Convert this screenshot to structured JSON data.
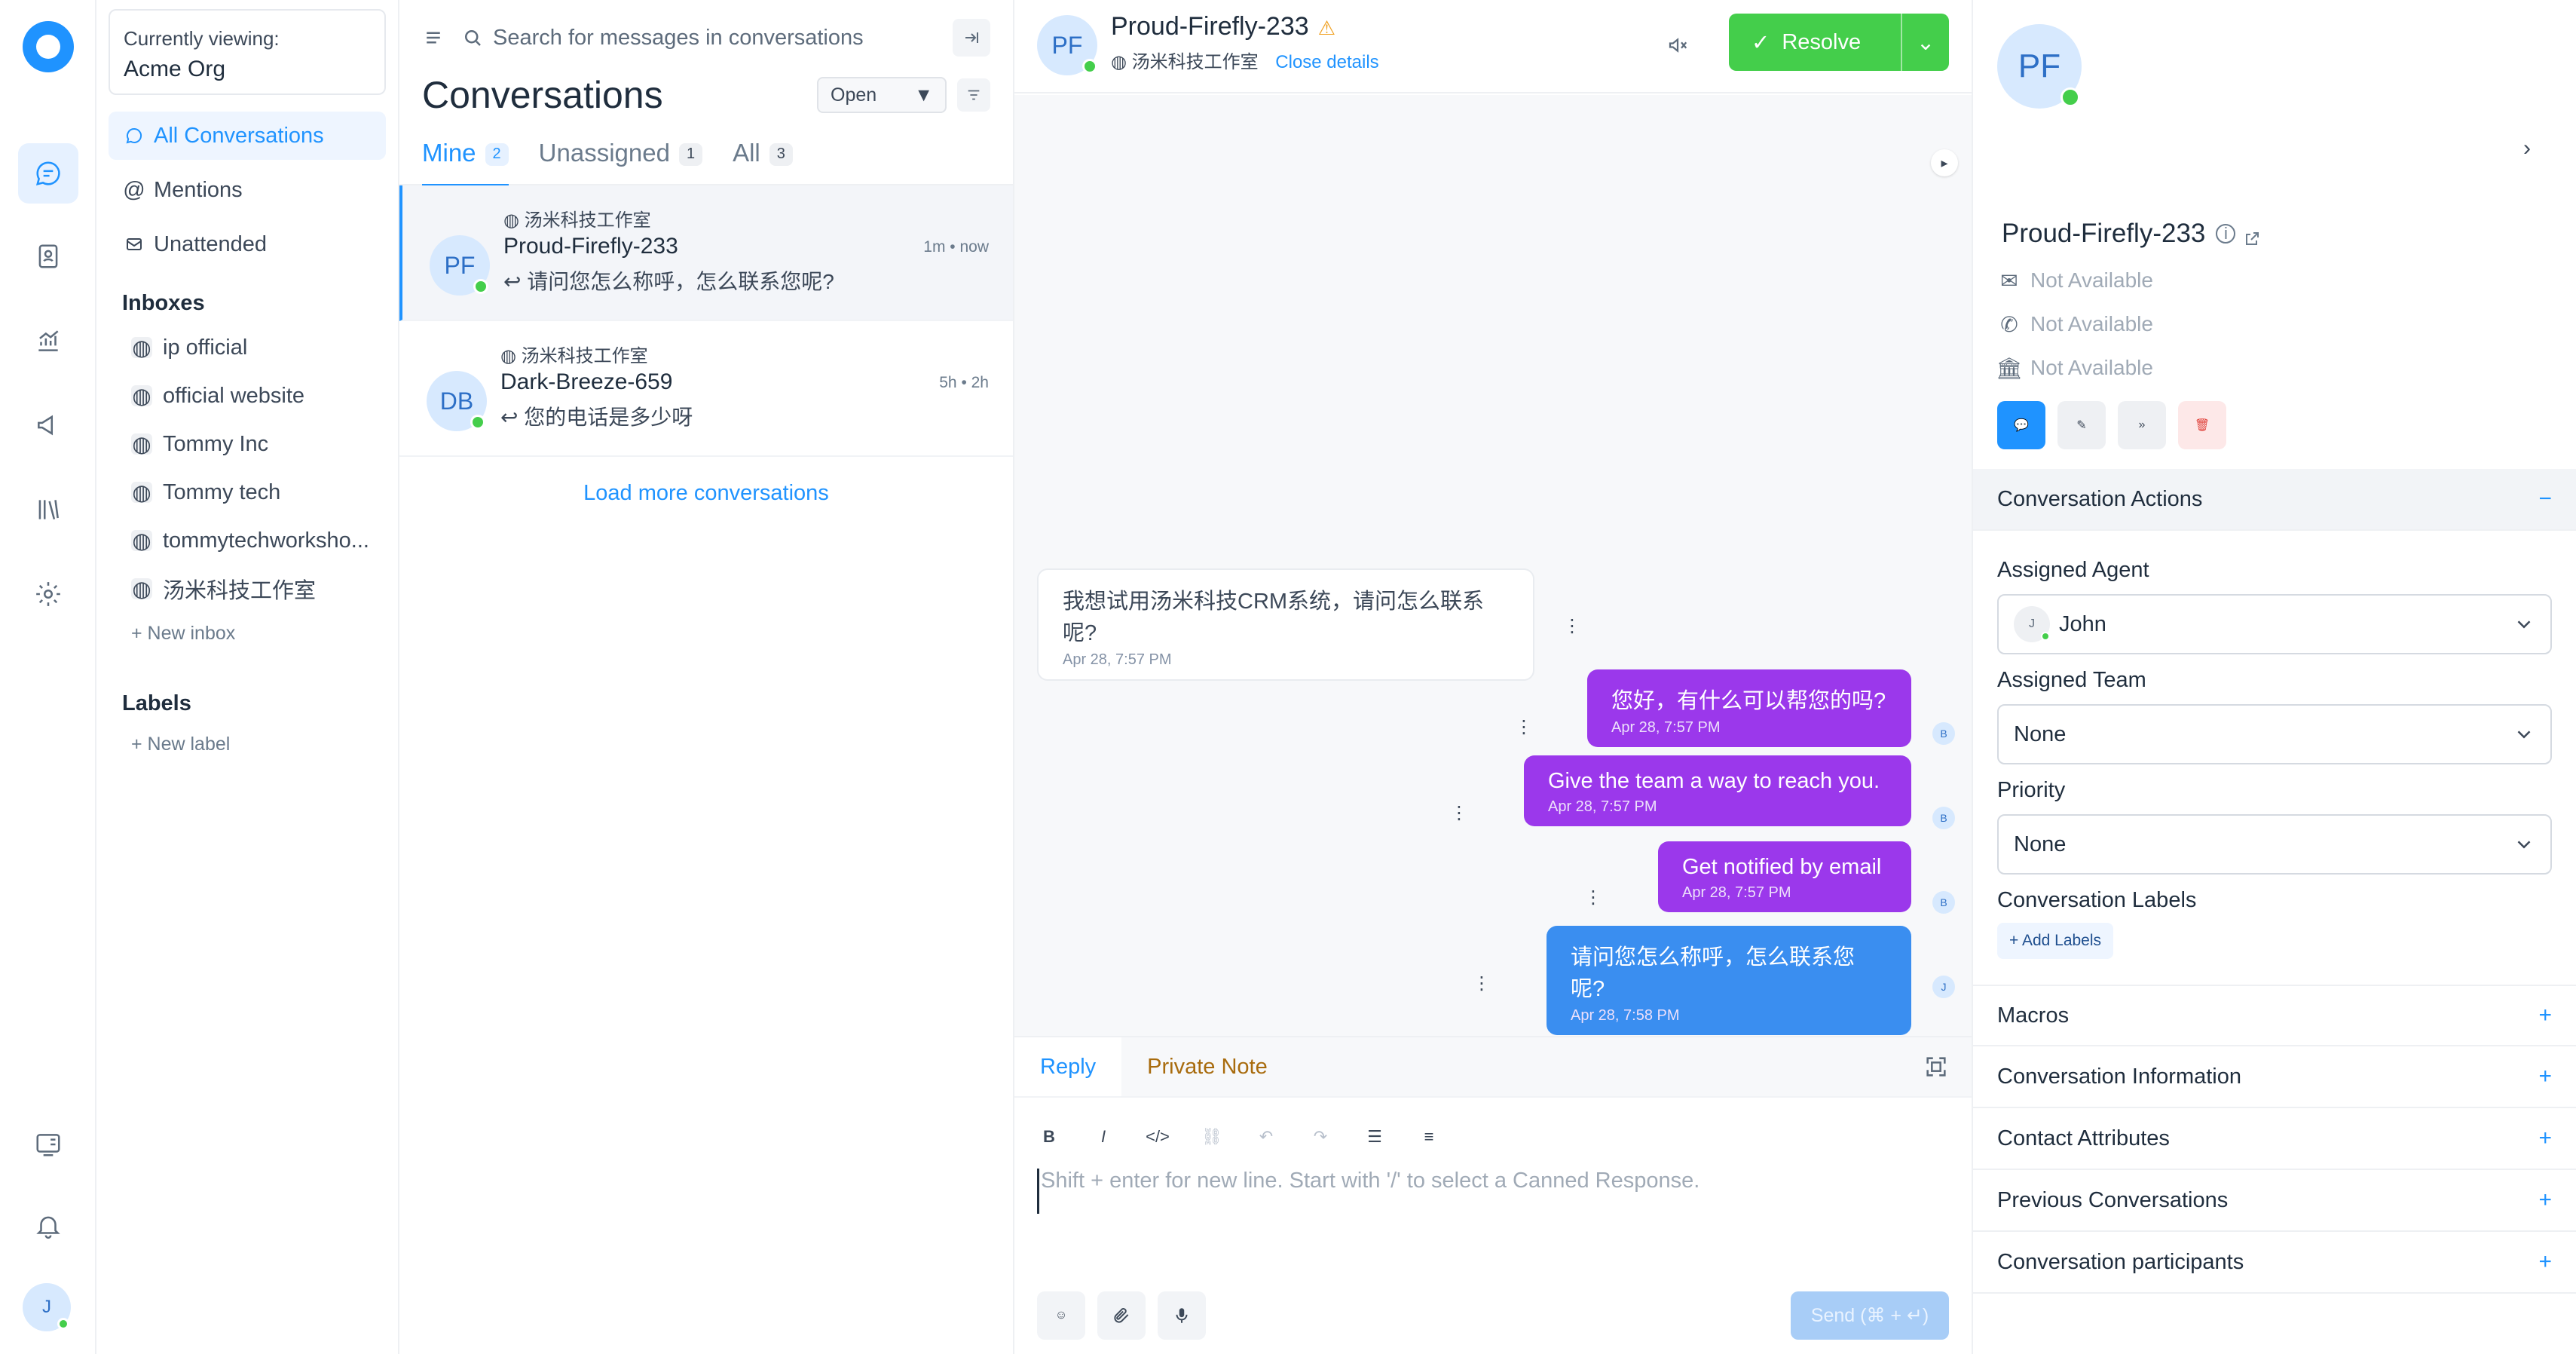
{
  "org": {
    "viewing_label": "Currently viewing:",
    "name": "Acme Org"
  },
  "nav": {
    "all": "All Conversations",
    "mentions": "Mentions",
    "unattended": "Unattended",
    "inboxes_heading": "Inboxes",
    "inboxes": [
      "ip official",
      "official website",
      "Tommy Inc",
      "Tommy tech",
      "tommytechworksho...",
      "汤米科技工作室"
    ],
    "new_inbox": "+ New inbox",
    "labels_heading": "Labels",
    "new_label": "+ New label"
  },
  "user": {
    "initial": "J"
  },
  "list": {
    "search_placeholder": "Search for messages in conversations",
    "title": "Conversations",
    "status": "Open",
    "tabs": [
      {
        "label": "Mine",
        "count": "2"
      },
      {
        "label": "Unassigned",
        "count": "1"
      },
      {
        "label": "All",
        "count": "3"
      }
    ],
    "conversations": [
      {
        "initials": "PF",
        "inbox": "汤米科技工作室",
        "name": "Proud-Firefly-233",
        "message": "请问您怎么称呼，怎么联系您呢?",
        "time": "1m • now"
      },
      {
        "initials": "DB",
        "inbox": "汤米科技工作室",
        "name": "Dark-Breeze-659",
        "message": "您的电话是多少呀",
        "time": "5h • 2h"
      }
    ],
    "load_more": "Load more conversations"
  },
  "chat": {
    "initials": "PF",
    "name": "Proud-Firefly-233",
    "inbox": "汤米科技工作室",
    "close_details": "Close details",
    "resolve": "Resolve",
    "messages": [
      {
        "text": "我想试用汤米科技CRM系统，请问怎么联系呢?",
        "time": "Apr 28, 7:57 PM"
      },
      {
        "text": "您好，有什么可以帮您的吗?",
        "time": "Apr 28, 7:57 PM"
      },
      {
        "text": "Give the team a way to reach you.",
        "time": "Apr 28, 7:57 PM"
      },
      {
        "text": "Get notified by email",
        "time": "Apr 28, 7:57 PM"
      },
      {
        "text": "请问您怎么称呼，怎么联系您呢?",
        "time": "Apr 28, 7:58 PM"
      }
    ],
    "sender_initial": "B",
    "agent_initial": "J",
    "reply_tab": "Reply",
    "note_tab": "Private Note",
    "editor_placeholder": "Shift + enter for new line. Start with '/' to select a Canned Response.",
    "send": "Send (⌘ + ↵)"
  },
  "contact": {
    "initials": "PF",
    "name": "Proud-Firefly-233",
    "email": "Not Available",
    "phone": "Not Available",
    "company": "Not Available",
    "actions_heading": "Conversation Actions",
    "assigned_agent_label": "Assigned Agent",
    "assigned_agent": "John",
    "assigned_agent_initial": "J",
    "assigned_team_label": "Assigned Team",
    "assigned_team": "None",
    "priority_label": "Priority",
    "priority": "None",
    "labels_label": "Conversation Labels",
    "add_labels": "+ Add Labels",
    "sections": [
      "Macros",
      "Conversation Information",
      "Contact Attributes",
      "Previous Conversations",
      "Conversation participants"
    ]
  },
  "colors": {
    "accent": "#1f93ff",
    "success": "#44ce4b",
    "agent_bubble": "#9b38eb",
    "bot_bubble": "#3a8ef0"
  }
}
